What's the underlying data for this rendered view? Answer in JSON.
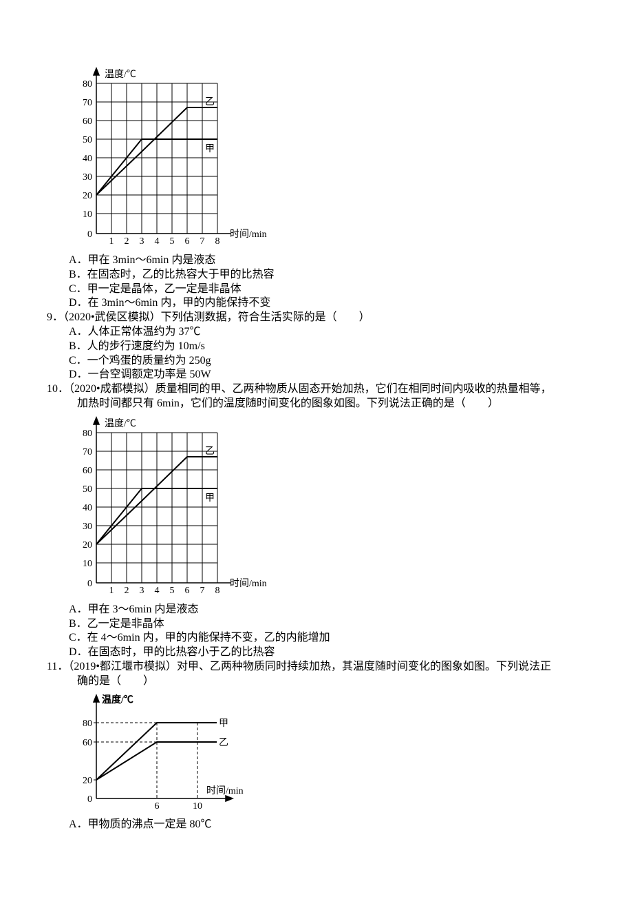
{
  "chart_data": [
    {
      "type": "line",
      "title": "",
      "xlabel": "时间/min",
      "ylabel": "温度/℃",
      "x_ticks": [
        1,
        2,
        3,
        4,
        5,
        6,
        7,
        8
      ],
      "y_ticks": [
        0,
        10,
        20,
        30,
        40,
        50,
        60,
        70,
        80
      ],
      "xlim": [
        0,
        8
      ],
      "ylim": [
        0,
        80
      ],
      "series": [
        {
          "name": "甲",
          "x": [
            0,
            3,
            6,
            8
          ],
          "values": [
            20,
            50,
            50,
            50
          ]
        },
        {
          "name": "乙",
          "x": [
            0,
            3,
            6,
            8
          ],
          "values": [
            20,
            44,
            68,
            68
          ]
        }
      ]
    },
    {
      "type": "line",
      "title": "",
      "xlabel": "时间/min",
      "ylabel": "温度/℃",
      "x_ticks": [
        1,
        2,
        3,
        4,
        5,
        6,
        7,
        8
      ],
      "y_ticks": [
        0,
        10,
        20,
        30,
        40,
        50,
        60,
        70,
        80
      ],
      "xlim": [
        0,
        8
      ],
      "ylim": [
        0,
        80
      ],
      "series": [
        {
          "name": "甲",
          "x": [
            0,
            3,
            6,
            8
          ],
          "values": [
            20,
            50,
            50,
            50
          ]
        },
        {
          "name": "乙",
          "x": [
            0,
            3,
            6,
            8
          ],
          "values": [
            20,
            44,
            68,
            68
          ]
        }
      ]
    },
    {
      "type": "line",
      "title": "",
      "xlabel": "时间/min",
      "ylabel": "温度/℃",
      "x_ticks": [
        6,
        10
      ],
      "y_ticks": [
        0,
        20,
        60,
        80
      ],
      "xlim": [
        0,
        12
      ],
      "ylim": [
        0,
        100
      ],
      "series": [
        {
          "name": "甲",
          "x": [
            0,
            6,
            10,
            12
          ],
          "values": [
            20,
            80,
            80,
            80
          ]
        },
        {
          "name": "乙",
          "x": [
            0,
            6,
            10,
            12
          ],
          "values": [
            20,
            60,
            60,
            60
          ]
        }
      ]
    }
  ],
  "q8": {
    "optA": "A．甲在 3min～6min 内是液态",
    "optB": "B．在固态时，乙的比热容大于甲的比热容",
    "optC": "C．甲一定是晶体，乙一定是非晶体",
    "optD": "D．在 3min～6min 内，甲的内能保持不变"
  },
  "q9": {
    "stem": "9．（2020•武侯区模拟）下列估测数据，符合生活实际的是（　　）",
    "optA": "A．人体正常体温约为 37℃",
    "optB": "B．人的步行速度约为 10m/s",
    "optC": "C．一个鸡蛋的质量约为 250g",
    "optD": "D．一台空调额定功率是 50W"
  },
  "q10": {
    "stem": "10．（2020•成都模拟）质量相同的甲、乙两种物质从固态开始加热，它们在相同时间内吸收的热量相等，",
    "stem2": "加热时间都只有 6min，它们的温度随时间变化的图象如图。下列说法正确的是（　　）",
    "optA": "A．甲在 3～6min 内是液态",
    "optB": "B．乙一定是非晶体",
    "optC": "C．在 4～6min 内，甲的内能保持不变，乙的内能增加",
    "optD": "D．在固态时，甲的比热容小于乙的比热容"
  },
  "q11": {
    "stem": "11．（2019•都江堰市模拟）对甲、乙两种物质同时持续加热，其温度随时间变化的图象如图。下列说法正",
    "stem2": "确的是（　　）",
    "optA": "A．甲物质的沸点一定是 80℃"
  },
  "labels": {
    "axis_y": "温度/℃",
    "axis_x": "时间/min",
    "jia": "甲",
    "yi": "乙"
  }
}
